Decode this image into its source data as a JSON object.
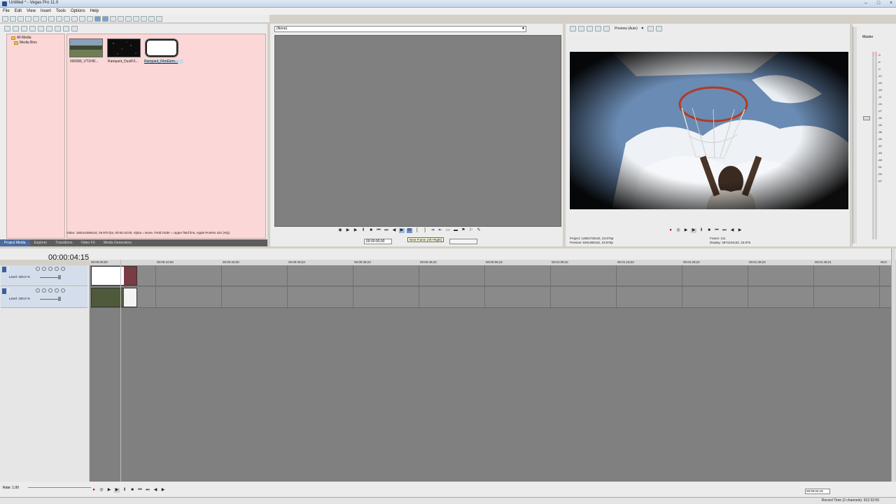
{
  "window": {
    "title": "Untitled * - Vegas Pro 11.0",
    "controls": [
      "–",
      "□",
      "×"
    ]
  },
  "menu": [
    "File",
    "Edit",
    "View",
    "Insert",
    "Tools",
    "Options",
    "Help"
  ],
  "project_media": {
    "tree": [
      {
        "label": "All Media"
      },
      {
        "label": "Media Bins"
      }
    ],
    "items": [
      {
        "label": "000589_VTXHD..."
      },
      {
        "label": "Rampant_DustFX..."
      },
      {
        "label": "Rampant_FilmElem..."
      }
    ],
    "status": "Video: 1920x1080x24, 29.970 fps, 00:00:10:00, Alpha = None, Field Order = Upper field first, Apple ProRes 422 (HQ)",
    "tabs": [
      "Project Media",
      "Explorer",
      "Transitions",
      "Video FX",
      "Media Generators"
    ]
  },
  "trimmer": {
    "combo": "(None)",
    "time": "00:00:00;00",
    "tooltip": "Next Frame (Alt+Right)"
  },
  "preview": {
    "mode": "Preview (Auto)",
    "project_label": "Project:",
    "project_value": "1280x720x32, 23.976p",
    "preview_label": "Preview:",
    "preview_value": "640x360x32, 23.976p",
    "frame_label": "Frame:",
    "frame_value": "111",
    "display_label": "Display:",
    "display_value": "397x224x32, 23.976"
  },
  "master": {
    "label": "Master",
    "scale": [
      "-3",
      "-6",
      "-9",
      "-12",
      "-15",
      "-18",
      "-21",
      "-24",
      "-27",
      "-30",
      "-33",
      "-36",
      "-39",
      "-42",
      "-45",
      "-48",
      "-51",
      "-54",
      "-57"
    ]
  },
  "timeline": {
    "timecode": "00:00:04:15",
    "ruler": [
      "00:00:00;00",
      "00:00:10;00",
      "00:00:20;00",
      "00:00:29;23",
      "00:00:39;23",
      "00:00:49;23",
      "00:00:59;23",
      "00:01:09;22",
      "00:01:19;22",
      "00:01:29;22",
      "00:01:39;22",
      "00:01:49;21",
      "00:0"
    ],
    "tracks": [
      {
        "number": "1",
        "level": "Level: 100.0 %"
      },
      {
        "number": "2",
        "level": "Level: 100.0 %"
      }
    ]
  },
  "transport": {
    "rate": "Rate: 1.00",
    "time": "00:00:04;15",
    "record_time": "Record Time (2 channels): 912:22:55"
  }
}
